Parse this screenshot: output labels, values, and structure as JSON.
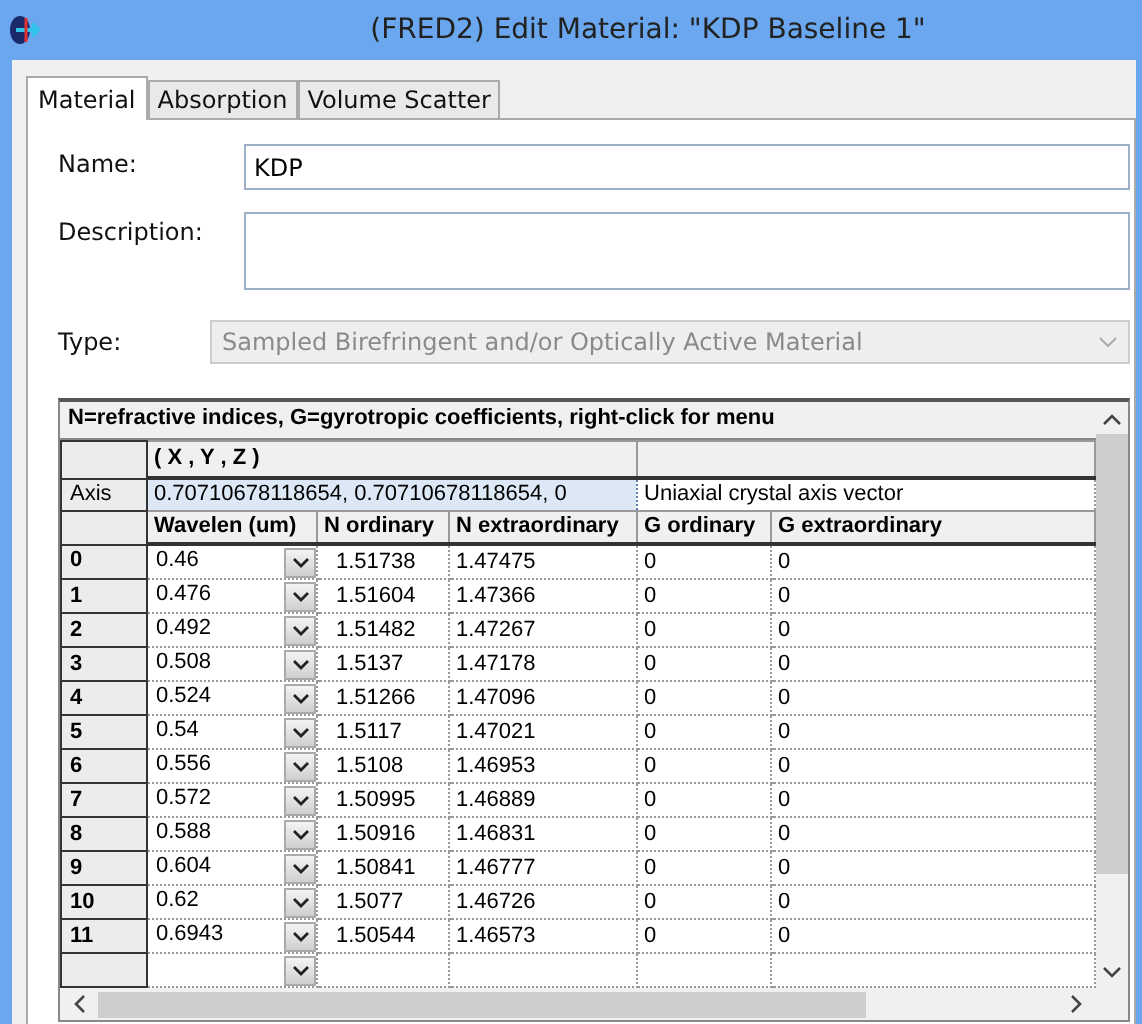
{
  "window": {
    "title": "(FRED2) Edit Material: \"KDP Baseline 1\""
  },
  "tabs": [
    {
      "label": "Material",
      "selected": true
    },
    {
      "label": "Absorption",
      "selected": false
    },
    {
      "label": "Volume Scatter",
      "selected": false
    }
  ],
  "form": {
    "name_label": "Name:",
    "name_value": "KDP",
    "description_label": "Description:",
    "type_label": "Type:",
    "type_value": "Sampled Birefringent and/or Optically Active Material",
    "type_disabled": true
  },
  "grid": {
    "caption": "N=refractive indices,  G=gyrotropic coefficients,  right-click for menu",
    "vector_header": "( X , Y , Z )",
    "axis_label": "Axis",
    "axis_value": "0.70710678118654,  0.70710678118654,  0",
    "axis_note": "Uniaxial crystal axis vector",
    "columns": [
      "Wavelen (um)",
      "N ordinary",
      "N extraordinary",
      "G ordinary",
      "G extraordinary"
    ],
    "rows": [
      {
        "index": "0",
        "cells": [
          "0.46",
          "1.51738",
          "1.47475",
          "0",
          "0"
        ]
      },
      {
        "index": "1",
        "cells": [
          "0.476",
          "1.51604",
          "1.47366",
          "0",
          "0"
        ]
      },
      {
        "index": "2",
        "cells": [
          "0.492",
          "1.51482",
          "1.47267",
          "0",
          "0"
        ]
      },
      {
        "index": "3",
        "cells": [
          "0.508",
          "1.5137",
          "1.47178",
          "0",
          "0"
        ]
      },
      {
        "index": "4",
        "cells": [
          "0.524",
          "1.51266",
          "1.47096",
          "0",
          "0"
        ]
      },
      {
        "index": "5",
        "cells": [
          "0.54",
          "1.5117",
          "1.47021",
          "0",
          "0"
        ]
      },
      {
        "index": "6",
        "cells": [
          "0.556",
          "1.5108",
          "1.46953",
          "0",
          "0"
        ]
      },
      {
        "index": "7",
        "cells": [
          "0.572",
          "1.50995",
          "1.46889",
          "0",
          "0"
        ]
      },
      {
        "index": "8",
        "cells": [
          "0.588",
          "1.50916",
          "1.46831",
          "0",
          "0"
        ]
      },
      {
        "index": "9",
        "cells": [
          "0.604",
          "1.50841",
          "1.46777",
          "0",
          "0"
        ]
      },
      {
        "index": "10",
        "cells": [
          "0.62",
          "1.5077",
          "1.46726",
          "0",
          "0"
        ]
      },
      {
        "index": "11",
        "cells": [
          "0.6943",
          "1.50544",
          "1.46573",
          "0",
          "0"
        ]
      }
    ]
  }
}
